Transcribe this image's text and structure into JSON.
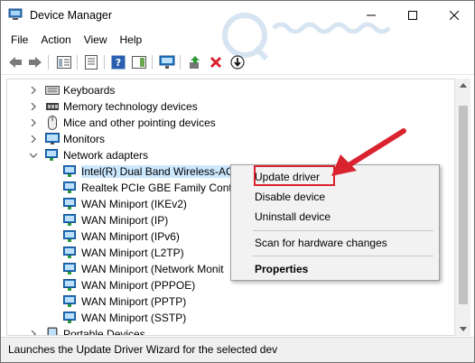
{
  "window": {
    "title": "Device Manager"
  },
  "menu": {
    "items": [
      "File",
      "Action",
      "View",
      "Help"
    ]
  },
  "toolbar": {
    "icons": [
      "back-arrow-icon",
      "forward-arrow-icon",
      "show-hide-tree-icon",
      "properties-icon",
      "help-icon",
      "action-pane-icon",
      "monitor-icon",
      "enable-device-icon",
      "uninstall-x-icon",
      "update-driver-icon"
    ]
  },
  "tree": {
    "rows": [
      {
        "label": "Keyboards",
        "expanded": false,
        "level": 1
      },
      {
        "label": "Memory technology devices",
        "expanded": false,
        "level": 1
      },
      {
        "label": "Mice and other pointing devices",
        "expanded": false,
        "level": 1
      },
      {
        "label": "Monitors",
        "expanded": false,
        "level": 1
      },
      {
        "label": "Network adapters",
        "expanded": true,
        "level": 1
      },
      {
        "label": "Intel(R) Dual Band Wireless-AC",
        "level": 2,
        "selected": true
      },
      {
        "label": "Realtek PCIe GBE Family Contro",
        "level": 2
      },
      {
        "label": "WAN Miniport (IKEv2)",
        "level": 2
      },
      {
        "label": "WAN Miniport (IP)",
        "level": 2
      },
      {
        "label": "WAN Miniport (IPv6)",
        "level": 2
      },
      {
        "label": "WAN Miniport (L2TP)",
        "level": 2
      },
      {
        "label": "WAN Miniport (Network Monit",
        "level": 2
      },
      {
        "label": "WAN Miniport (PPPOE)",
        "level": 2
      },
      {
        "label": "WAN Miniport (PPTP)",
        "level": 2
      },
      {
        "label": "WAN Miniport (SSTP)",
        "level": 2
      },
      {
        "label": "Portable Devices",
        "expanded": false,
        "level": 1
      }
    ]
  },
  "context_menu": {
    "items": [
      {
        "label": "Update driver",
        "bold": false,
        "highlighted": true
      },
      {
        "label": "Disable device",
        "bold": false
      },
      {
        "label": "Uninstall device",
        "bold": false
      },
      {
        "label": "Scan for hardware changes",
        "bold": false
      },
      {
        "label": "Properties",
        "bold": true
      }
    ]
  },
  "status": {
    "text": "Launches the Update Driver Wizard for the selected dev"
  },
  "colors": {
    "accent_red": "#d9232e",
    "selection": "#cce8ff",
    "icon_blue": "#1e78c8"
  }
}
